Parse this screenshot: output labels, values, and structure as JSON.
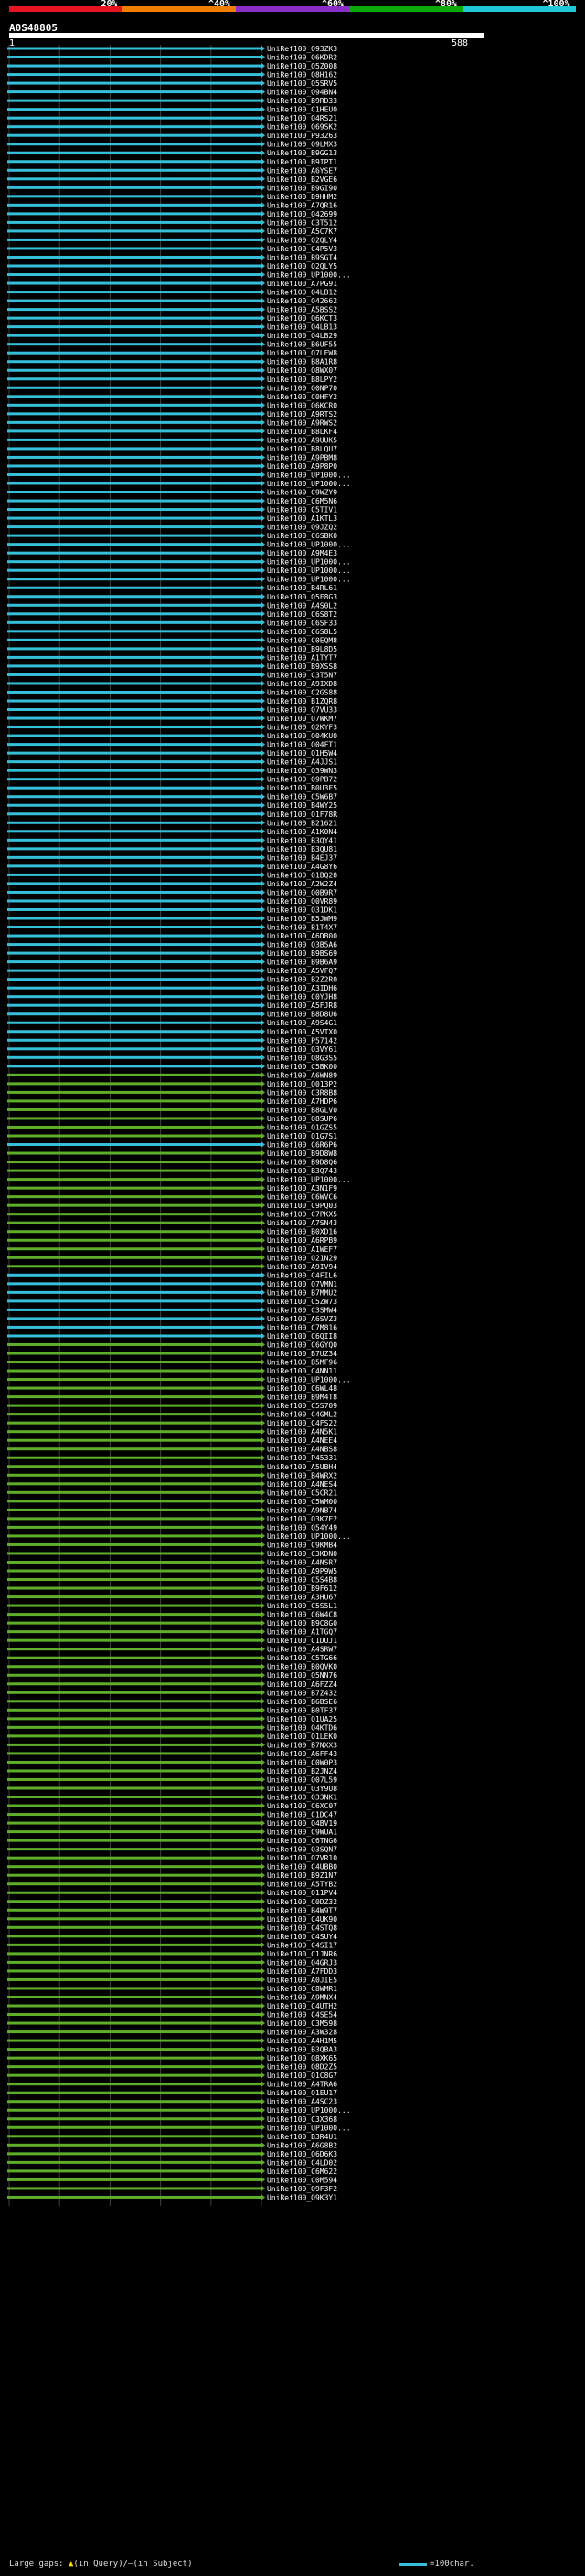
{
  "header": {
    "scale_labels": [
      "20%",
      "^40%",
      "^60%",
      "^80%",
      "^100%"
    ],
    "scale_colors": [
      "#e5141e",
      "#f07e00",
      "#8b2ec8",
      "#0ca80c",
      "#1fc7d8"
    ],
    "query_id": "A0S48805",
    "query_start": "1",
    "query_end": "588"
  },
  "colors": {
    "cyan_hit": "#36bfd8",
    "green_hit": "#5fae2a",
    "background": "#000000",
    "gridline": "#ffffff"
  },
  "hits": [
    {
      "id": "UniRef100_Q93ZK3",
      "color": "cyan"
    },
    {
      "id": "UniRef100_Q6KDR2",
      "color": "cyan"
    },
    {
      "id": "UniRef100_Q5Z008",
      "color": "cyan"
    },
    {
      "id": "UniRef100_Q8H162",
      "color": "cyan"
    },
    {
      "id": "UniRef100_Q5SRV5",
      "color": "cyan"
    },
    {
      "id": "UniRef100_Q94BN4",
      "color": "cyan"
    },
    {
      "id": "UniRef100_B9RD33",
      "color": "cyan"
    },
    {
      "id": "UniRef100_C1HEU0",
      "color": "cyan"
    },
    {
      "id": "UniRef100_Q4RS21",
      "color": "cyan"
    },
    {
      "id": "UniRef100_Q69SK2",
      "color": "cyan"
    },
    {
      "id": "UniRef100_P93263",
      "color": "cyan"
    },
    {
      "id": "UniRef100_Q9LMX3",
      "color": "cyan"
    },
    {
      "id": "UniRef100_B9GG13",
      "color": "cyan"
    },
    {
      "id": "UniRef100_B9IPT1",
      "color": "cyan"
    },
    {
      "id": "UniRef100_A6YSE7",
      "color": "cyan"
    },
    {
      "id": "UniRef100_B2VGE6",
      "color": "cyan"
    },
    {
      "id": "UniRef100_B9GI90",
      "color": "cyan"
    },
    {
      "id": "UniRef100_B9HHM2",
      "color": "cyan"
    },
    {
      "id": "UniRef100_A7QR16",
      "color": "cyan"
    },
    {
      "id": "UniRef100_Q42699",
      "color": "cyan"
    },
    {
      "id": "UniRef100_C3T512",
      "color": "cyan"
    },
    {
      "id": "UniRef100_A5C7K7",
      "color": "cyan"
    },
    {
      "id": "UniRef100_Q2QLY4",
      "color": "cyan"
    },
    {
      "id": "UniRef100_C4P5V3",
      "color": "cyan"
    },
    {
      "id": "UniRef100_B9SGT4",
      "color": "cyan"
    },
    {
      "id": "UniRef100_Q2QLY5",
      "color": "cyan"
    },
    {
      "id": "UniRef100_UP1000...",
      "color": "cyan"
    },
    {
      "id": "UniRef100_A7PG91",
      "color": "cyan"
    },
    {
      "id": "UniRef100_Q4LB12",
      "color": "cyan"
    },
    {
      "id": "UniRef100_Q42662",
      "color": "cyan"
    },
    {
      "id": "UniRef100_A5BSS2",
      "color": "cyan"
    },
    {
      "id": "UniRef100_Q6KCT3",
      "color": "cyan"
    },
    {
      "id": "UniRef100_Q4LB13",
      "color": "cyan"
    },
    {
      "id": "UniRef100_Q4LB29",
      "color": "cyan"
    },
    {
      "id": "UniRef100_B6UF55",
      "color": "cyan"
    },
    {
      "id": "UniRef100_Q7LEW8",
      "color": "cyan"
    },
    {
      "id": "UniRef100_B8A1R8",
      "color": "cyan"
    },
    {
      "id": "UniRef100_Q8WX07",
      "color": "cyan"
    },
    {
      "id": "UniRef100_B8LPY2",
      "color": "cyan"
    },
    {
      "id": "UniRef100_Q0NP70",
      "color": "cyan"
    },
    {
      "id": "UniRef100_C0HFY2",
      "color": "cyan"
    },
    {
      "id": "UniRef100_Q6KCR0",
      "color": "cyan"
    },
    {
      "id": "UniRef100_A9RTS2",
      "color": "cyan"
    },
    {
      "id": "UniRef100_A9RWS2",
      "color": "cyan"
    },
    {
      "id": "UniRef100_B8LKF4",
      "color": "cyan"
    },
    {
      "id": "UniRef100_A9UUK5",
      "color": "cyan"
    },
    {
      "id": "UniRef100_B8LQU7",
      "color": "cyan"
    },
    {
      "id": "UniRef100_A9PBM8",
      "color": "cyan"
    },
    {
      "id": "UniRef100_A9P8P0",
      "color": "cyan"
    },
    {
      "id": "UniRef100_UP1000...",
      "color": "cyan"
    },
    {
      "id": "UniRef100_UP1000...",
      "color": "cyan"
    },
    {
      "id": "UniRef100_C9WZY9",
      "color": "cyan"
    },
    {
      "id": "UniRef100_C6M5N6",
      "color": "cyan"
    },
    {
      "id": "UniRef100_C5TIV1",
      "color": "cyan"
    },
    {
      "id": "UniRef100_A1KTL3",
      "color": "cyan"
    },
    {
      "id": "UniRef100_Q9JZQ2",
      "color": "cyan"
    },
    {
      "id": "UniRef100_C6SBK0",
      "color": "cyan"
    },
    {
      "id": "UniRef100_UP1000...",
      "color": "cyan"
    },
    {
      "id": "UniRef100_A9M4E3",
      "color": "cyan"
    },
    {
      "id": "UniRef100_UP1000...",
      "color": "cyan"
    },
    {
      "id": "UniRef100_UP1000...",
      "color": "cyan"
    },
    {
      "id": "UniRef100_UP1000...",
      "color": "cyan"
    },
    {
      "id": "UniRef100_B4RL61",
      "color": "cyan"
    },
    {
      "id": "UniRef100_Q5F8G3",
      "color": "cyan"
    },
    {
      "id": "UniRef100_A4S0L2",
      "color": "cyan"
    },
    {
      "id": "UniRef100_C6S8T2",
      "color": "cyan"
    },
    {
      "id": "UniRef100_C6SF33",
      "color": "cyan"
    },
    {
      "id": "UniRef100_C6S8L5",
      "color": "cyan"
    },
    {
      "id": "UniRef100_C0EQM8",
      "color": "cyan"
    },
    {
      "id": "UniRef100_B9L8D5",
      "color": "cyan"
    },
    {
      "id": "UniRef100_A1TYT7",
      "color": "cyan"
    },
    {
      "id": "UniRef100_B9XSS8",
      "color": "cyan"
    },
    {
      "id": "UniRef100_C3T5N7",
      "color": "cyan"
    },
    {
      "id": "UniRef100_A9IXD8",
      "color": "cyan"
    },
    {
      "id": "UniRef100_C2GS88",
      "color": "cyan"
    },
    {
      "id": "UniRef100_B1ZQR8",
      "color": "cyan"
    },
    {
      "id": "UniRef100_Q7VU33",
      "color": "cyan"
    },
    {
      "id": "UniRef100_Q7WKM7",
      "color": "cyan"
    },
    {
      "id": "UniRef100_Q2KYF3",
      "color": "cyan"
    },
    {
      "id": "UniRef100_Q04KU0",
      "color": "cyan"
    },
    {
      "id": "UniRef100_Q04FT1",
      "color": "cyan"
    },
    {
      "id": "UniRef100_Q1H5W4",
      "color": "cyan"
    },
    {
      "id": "UniRef100_A4JJS1",
      "color": "cyan"
    },
    {
      "id": "UniRef100_Q39WN3",
      "color": "cyan"
    },
    {
      "id": "UniRef100_Q9PB72",
      "color": "cyan"
    },
    {
      "id": "UniRef100_B0U3F5",
      "color": "cyan"
    },
    {
      "id": "UniRef100_C5W6B7",
      "color": "cyan"
    },
    {
      "id": "UniRef100_B4WY25",
      "color": "cyan"
    },
    {
      "id": "UniRef100_Q1F78R",
      "color": "cyan"
    },
    {
      "id": "UniRef100_B21621",
      "color": "cyan"
    },
    {
      "id": "UniRef100_A1K0N4",
      "color": "cyan"
    },
    {
      "id": "UniRef100_B3QY41",
      "color": "cyan"
    },
    {
      "id": "UniRef100_B3QU81",
      "color": "cyan"
    },
    {
      "id": "UniRef100_B4EJ37",
      "color": "cyan"
    },
    {
      "id": "UniRef100_A4G8Y6",
      "color": "cyan"
    },
    {
      "id": "UniRef100_Q1BQ28",
      "color": "cyan"
    },
    {
      "id": "UniRef100_A2W2Z4",
      "color": "cyan"
    },
    {
      "id": "UniRef100_Q0B9R7",
      "color": "cyan"
    },
    {
      "id": "UniRef100_Q0VR89",
      "color": "cyan"
    },
    {
      "id": "UniRef100_Q31DK1",
      "color": "cyan"
    },
    {
      "id": "UniRef100_B5JWM9",
      "color": "cyan"
    },
    {
      "id": "UniRef100_B1T4X7",
      "color": "cyan"
    },
    {
      "id": "UniRef100_A6DB00",
      "color": "cyan"
    },
    {
      "id": "UniRef100_Q3B5A6",
      "color": "cyan"
    },
    {
      "id": "UniRef100_B9BS69",
      "color": "cyan"
    },
    {
      "id": "UniRef100_B9B6A9",
      "color": "cyan"
    },
    {
      "id": "UniRef100_A5VFQ7",
      "color": "cyan"
    },
    {
      "id": "UniRef100_B2Z2R0",
      "color": "cyan"
    },
    {
      "id": "UniRef100_A3IDH6",
      "color": "cyan"
    },
    {
      "id": "UniRef100_C0YJH8",
      "color": "cyan"
    },
    {
      "id": "UniRef100_A5FJR8",
      "color": "cyan"
    },
    {
      "id": "UniRef100_B8D8U6",
      "color": "cyan"
    },
    {
      "id": "UniRef100_A9S4G1",
      "color": "cyan"
    },
    {
      "id": "UniRef100_A5VTX0",
      "color": "cyan"
    },
    {
      "id": "UniRef100_P57142",
      "color": "cyan"
    },
    {
      "id": "UniRef100_Q3VY61",
      "color": "cyan"
    },
    {
      "id": "UniRef100_Q8G3S5",
      "color": "cyan"
    },
    {
      "id": "UniRef100_C5BK00",
      "color": "cyan"
    },
    {
      "id": "UniRef100_A6WN89",
      "color": "green"
    },
    {
      "id": "UniRef100_Q013P2",
      "color": "green"
    },
    {
      "id": "UniRef100_C3R8B8",
      "color": "green"
    },
    {
      "id": "UniRef100_A7HDP6",
      "color": "green"
    },
    {
      "id": "UniRef100_B8GLV0",
      "color": "green"
    },
    {
      "id": "UniRef100_Q8SUP6",
      "color": "green"
    },
    {
      "id": "UniRef100_Q1GZS5",
      "color": "green"
    },
    {
      "id": "UniRef100_Q1G7S1",
      "color": "green"
    },
    {
      "id": "UniRef100_C6R6P6",
      "color": "cyan"
    },
    {
      "id": "UniRef100_B9D8W8",
      "color": "green"
    },
    {
      "id": "UniRef100_B9D8Q6",
      "color": "green"
    },
    {
      "id": "UniRef100_B3Q743",
      "color": "green"
    },
    {
      "id": "UniRef100_UP1000...",
      "color": "green"
    },
    {
      "id": "UniRef100_A3N1F9",
      "color": "green"
    },
    {
      "id": "UniRef100_C6WVC6",
      "color": "green"
    },
    {
      "id": "UniRef100_C9PQ03",
      "color": "green"
    },
    {
      "id": "UniRef100_C7PKX5",
      "color": "green"
    },
    {
      "id": "UniRef100_A7SN43",
      "color": "green"
    },
    {
      "id": "UniRef100_B0XD16",
      "color": "green"
    },
    {
      "id": "UniRef100_A6RPB9",
      "color": "green"
    },
    {
      "id": "UniRef100_A1WEF7",
      "color": "green"
    },
    {
      "id": "UniRef100_Q21N29",
      "color": "green"
    },
    {
      "id": "UniRef100_A9IV94",
      "color": "green"
    },
    {
      "id": "UniRef100_C4FIL6",
      "color": "cyan"
    },
    {
      "id": "UniRef100_Q7VMN1",
      "color": "cyan"
    },
    {
      "id": "UniRef100_B7MMU2",
      "color": "cyan"
    },
    {
      "id": "UniRef100_C5ZW73",
      "color": "cyan"
    },
    {
      "id": "UniRef100_C3SMW4",
      "color": "cyan"
    },
    {
      "id": "UniRef100_A6SVZ3",
      "color": "cyan"
    },
    {
      "id": "UniRef100_C7M816",
      "color": "cyan"
    },
    {
      "id": "UniRef100_C6QII8",
      "color": "cyan"
    },
    {
      "id": "UniRef100_C6GYQ0",
      "color": "green"
    },
    {
      "id": "UniRef100_B7UZ34",
      "color": "green"
    },
    {
      "id": "UniRef100_B5MF96",
      "color": "green"
    },
    {
      "id": "UniRef100_C4NN11",
      "color": "green"
    },
    {
      "id": "UniRef100_UP1000...",
      "color": "green"
    },
    {
      "id": "UniRef100_C6WL48",
      "color": "green"
    },
    {
      "id": "UniRef100_B9M4T8",
      "color": "green"
    },
    {
      "id": "UniRef100_C5S709",
      "color": "green"
    },
    {
      "id": "UniRef100_C4GML2",
      "color": "green"
    },
    {
      "id": "UniRef100_C4FS22",
      "color": "green"
    },
    {
      "id": "UniRef100_A4N5K1",
      "color": "green"
    },
    {
      "id": "UniRef100_A4NEE4",
      "color": "green"
    },
    {
      "id": "UniRef100_A4NBS8",
      "color": "green"
    },
    {
      "id": "UniRef100_P45331",
      "color": "green"
    },
    {
      "id": "UniRef100_A5UBH4",
      "color": "green"
    },
    {
      "id": "UniRef100_B4WRX2",
      "color": "green"
    },
    {
      "id": "UniRef100_A4NES4",
      "color": "green"
    },
    {
      "id": "UniRef100_C5CR21",
      "color": "green"
    },
    {
      "id": "UniRef100_C5WM00",
      "color": "green"
    },
    {
      "id": "UniRef100_A9NB74",
      "color": "green"
    },
    {
      "id": "UniRef100_Q3K7E2",
      "color": "green"
    },
    {
      "id": "UniRef100_Q54Y49",
      "color": "green"
    },
    {
      "id": "UniRef100_UP1000...",
      "color": "green"
    },
    {
      "id": "UniRef100_C9KMB4",
      "color": "green"
    },
    {
      "id": "UniRef100_C3KDN0",
      "color": "green"
    },
    {
      "id": "UniRef100_A4NSR7",
      "color": "green"
    },
    {
      "id": "UniRef100_A9P9W5",
      "color": "green"
    },
    {
      "id": "UniRef100_C5S4B8",
      "color": "green"
    },
    {
      "id": "UniRef100_B9F612",
      "color": "green"
    },
    {
      "id": "UniRef100_A3HU67",
      "color": "green"
    },
    {
      "id": "UniRef100_C5S5L1",
      "color": "green"
    },
    {
      "id": "UniRef100_C6W4C8",
      "color": "green"
    },
    {
      "id": "UniRef100_B9C8G0",
      "color": "green"
    },
    {
      "id": "UniRef100_A1TGQ7",
      "color": "green"
    },
    {
      "id": "UniRef100_C1DUJ1",
      "color": "green"
    },
    {
      "id": "UniRef100_A4SRW7",
      "color": "green"
    },
    {
      "id": "UniRef100_C5TG66",
      "color": "green"
    },
    {
      "id": "UniRef100_B0QVK0",
      "color": "green"
    },
    {
      "id": "UniRef100_Q5NN76",
      "color": "green"
    },
    {
      "id": "UniRef100_A6FZZ4",
      "color": "green"
    },
    {
      "id": "UniRef100_B7Z432",
      "color": "green"
    },
    {
      "id": "UniRef100_B6BSE6",
      "color": "green"
    },
    {
      "id": "UniRef100_B0TF37",
      "color": "green"
    },
    {
      "id": "UniRef100_Q1UA25",
      "color": "green"
    },
    {
      "id": "UniRef100_Q4KTD6",
      "color": "green"
    },
    {
      "id": "UniRef100_Q1LEK0",
      "color": "green"
    },
    {
      "id": "UniRef100_B7NXX3",
      "color": "green"
    },
    {
      "id": "UniRef100_A6FF43",
      "color": "green"
    },
    {
      "id": "UniRef100_C0W0P3",
      "color": "green"
    },
    {
      "id": "UniRef100_B2JNZ4",
      "color": "green"
    },
    {
      "id": "UniRef100_Q07L59",
      "color": "green"
    },
    {
      "id": "UniRef100_Q3Y9U8",
      "color": "green"
    },
    {
      "id": "UniRef100_Q33NK1",
      "color": "green"
    },
    {
      "id": "UniRef100_C6XC07",
      "color": "green"
    },
    {
      "id": "UniRef100_C1DC47",
      "color": "green"
    },
    {
      "id": "UniRef100_Q4BV19",
      "color": "green"
    },
    {
      "id": "UniRef100_C9WUA1",
      "color": "green"
    },
    {
      "id": "UniRef100_C6TNG6",
      "color": "green"
    },
    {
      "id": "UniRef100_Q3SQN7",
      "color": "green"
    },
    {
      "id": "UniRef100_Q7VR10",
      "color": "green"
    },
    {
      "id": "UniRef100_C4UBB0",
      "color": "green"
    },
    {
      "id": "UniRef100_B9Z1N7",
      "color": "green"
    },
    {
      "id": "UniRef100_A5TYB2",
      "color": "green"
    },
    {
      "id": "UniRef100_Q11PV4",
      "color": "green"
    },
    {
      "id": "UniRef100_C0DZ32",
      "color": "green"
    },
    {
      "id": "UniRef100_B4W9T7",
      "color": "green"
    },
    {
      "id": "UniRef100_C4UK90",
      "color": "green"
    },
    {
      "id": "UniRef100_C4STQ8",
      "color": "green"
    },
    {
      "id": "UniRef100_C4SUY4",
      "color": "green"
    },
    {
      "id": "UniRef100_C4SI17",
      "color": "green"
    },
    {
      "id": "UniRef100_C1JNR6",
      "color": "green"
    },
    {
      "id": "UniRef100_Q4GRJ3",
      "color": "green"
    },
    {
      "id": "UniRef100_A7FDD3",
      "color": "green"
    },
    {
      "id": "UniRef100_A0JIE5",
      "color": "green"
    },
    {
      "id": "UniRef100_C8WMR1",
      "color": "green"
    },
    {
      "id": "UniRef100_A9MNX4",
      "color": "green"
    },
    {
      "id": "UniRef100_C4UTH2",
      "color": "green"
    },
    {
      "id": "UniRef100_C4SE54",
      "color": "green"
    },
    {
      "id": "UniRef100_C3M598",
      "color": "green"
    },
    {
      "id": "UniRef100_A3W328",
      "color": "green"
    },
    {
      "id": "UniRef100_A4H1M5",
      "color": "green"
    },
    {
      "id": "UniRef100_B3QBA3",
      "color": "green"
    },
    {
      "id": "UniRef100_Q8XK65",
      "color": "green"
    },
    {
      "id": "UniRef100_Q8D2Z5",
      "color": "green"
    },
    {
      "id": "UniRef100_Q1C8G7",
      "color": "green"
    },
    {
      "id": "UniRef100_A4TRA6",
      "color": "green"
    },
    {
      "id": "UniRef100_Q1EU17",
      "color": "green"
    },
    {
      "id": "UniRef100_A4SC23",
      "color": "green"
    },
    {
      "id": "UniRef100_UP1000...",
      "color": "green"
    },
    {
      "id": "UniRef100_C3X368",
      "color": "green"
    },
    {
      "id": "UniRef100_UP1000...",
      "color": "green"
    },
    {
      "id": "UniRef100_B3R4U1",
      "color": "green"
    },
    {
      "id": "UniRef100_A6G8B2",
      "color": "green"
    },
    {
      "id": "UniRef100_Q6D6K3",
      "color": "green"
    },
    {
      "id": "UniRef100_C4LD02",
      "color": "green"
    },
    {
      "id": "UniRef100_C6M622",
      "color": "green"
    },
    {
      "id": "UniRef100_C0M594",
      "color": "green"
    },
    {
      "id": "UniRef100_Q9F3F2",
      "color": "green"
    },
    {
      "id": "UniRef100_Q9K3Y1",
      "color": "green"
    }
  ],
  "footer": {
    "large_gaps_label": "Large gaps:",
    "in_query_label": "(in Query)",
    "separator": "/",
    "in_subject_label": "(in Subject)",
    "legend_label": "=100char."
  }
}
